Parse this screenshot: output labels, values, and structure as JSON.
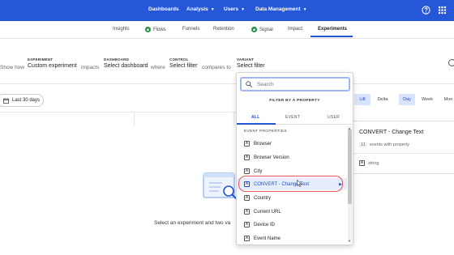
{
  "topnav": {
    "items": [
      {
        "label": "Dashboards",
        "caret": false
      },
      {
        "label": "Analysis",
        "caret": true
      },
      {
        "label": "Users",
        "caret": true
      },
      {
        "label": "Data Management",
        "caret": true
      }
    ],
    "icons": [
      "help-icon",
      "apps-grid-icon"
    ]
  },
  "subnav": {
    "tabs": [
      {
        "label": "Insights",
        "badge": false
      },
      {
        "label": "Flows",
        "badge": true
      },
      {
        "label": "Funnels",
        "badge": false
      },
      {
        "label": "Retention",
        "badge": false
      },
      {
        "label": "Signal",
        "badge": true
      },
      {
        "label": "Impact",
        "badge": false
      },
      {
        "label": "Experiments",
        "badge": false
      }
    ],
    "active": "Experiments"
  },
  "query": {
    "fragments": [
      "Show how",
      "impacts",
      "where",
      "compares to"
    ],
    "experiment": {
      "caption": "EXPERIMENT",
      "value": "Custom experiment"
    },
    "dashboard": {
      "caption": "DASHBOARD",
      "value": "Select dashboard"
    },
    "control": {
      "caption": "CONTROL",
      "value": "Select filter"
    },
    "variant": {
      "caption": "VARIANT",
      "value": "Select filter"
    }
  },
  "date_range": {
    "label": "Last 30 days"
  },
  "empty_state": {
    "text": "Select an experiment and two va"
  },
  "right_panel": {
    "toggles": [
      "Lift",
      "Delta",
      "Day",
      "Week",
      "Mon"
    ],
    "selected_toggles": [
      "Lift",
      "Day"
    ],
    "card": {
      "title": "CONVERT - Change Text",
      "count": "11",
      "count_suffix": "events with property",
      "type_label": "string",
      "type_icon": "A"
    }
  },
  "dropdown": {
    "search_placeholder": "Search",
    "filter_label": "FILTER BY A PROPERTY",
    "tabs": [
      "ALL",
      "EVENT",
      "USER"
    ],
    "active_tab": "ALL",
    "section_label": "EVENT PROPERTIES",
    "items": [
      {
        "label": "Browser",
        "highlighted": false
      },
      {
        "label": "Browser Version",
        "highlighted": false
      },
      {
        "label": "City",
        "highlighted": false
      },
      {
        "label": "CONVERT - Change Text",
        "highlighted": true
      },
      {
        "label": "Country",
        "highlighted": false
      },
      {
        "label": "Current URL",
        "highlighted": false
      },
      {
        "label": "Device ID",
        "highlighted": false
      },
      {
        "label": "Event Name",
        "highlighted": false
      }
    ],
    "item_icon": "A"
  },
  "colors": {
    "nav_blue": "#2557d6",
    "highlight_bg": "#e6edfb",
    "highlight_ring": "#e05757",
    "badge_green": "#1e8e3e"
  }
}
